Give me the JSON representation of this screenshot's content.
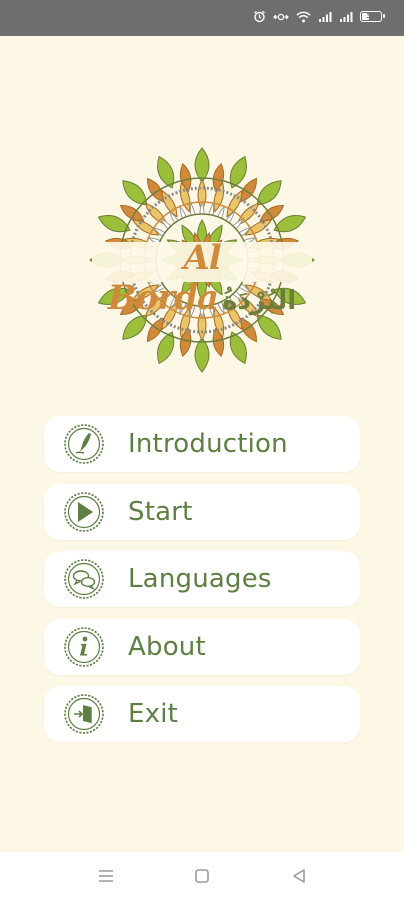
{
  "status_bar": {
    "icons": [
      "alarm-icon",
      "data-transfer-icon",
      "wifi-icon",
      "signal-icon",
      "signal-icon",
      "battery-icon"
    ],
    "battery_level": "35",
    "color": "#6e6e6e"
  },
  "logo": {
    "latin": "Al Borda",
    "arabic": "البُرْدَةُ",
    "colors": {
      "orange": "#d08a3c",
      "green": "#9bbf3a",
      "olive": "#6b7f3a"
    }
  },
  "menu": {
    "items": [
      {
        "label": "Introduction",
        "icon": "quill-icon"
      },
      {
        "label": "Start",
        "icon": "play-icon"
      },
      {
        "label": "Languages",
        "icon": "chat-bubbles-icon"
      },
      {
        "label": "About",
        "icon": "info-icon"
      },
      {
        "label": "Exit",
        "icon": "exit-door-icon"
      }
    ],
    "accent": "#5e7f42"
  },
  "nav_bar": {
    "buttons": [
      "menu-icon",
      "home-square-icon",
      "back-triangle-icon"
    ]
  },
  "background": "#fdf8e6"
}
